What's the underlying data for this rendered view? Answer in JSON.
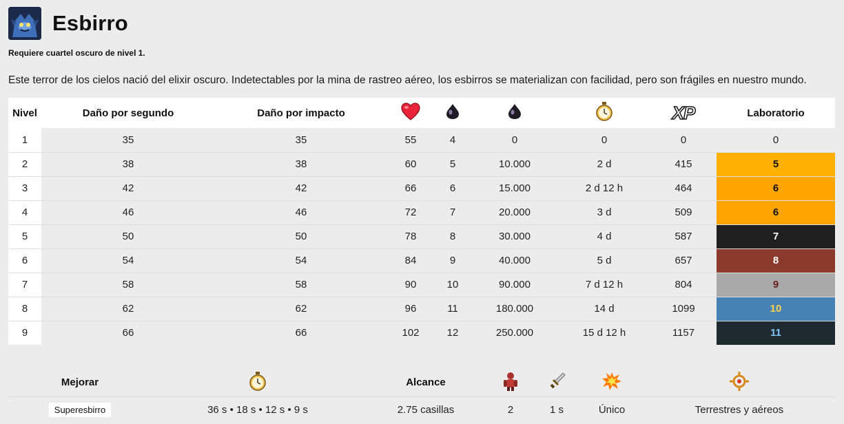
{
  "header": {
    "title": "Esbirro",
    "requirement": "Requiere cuartel oscuro de nivel 1.",
    "description": "Este terror de los cielos nació del elixir oscuro. Indetectables por la mina de rastreo aéreo, los esbirros se materializan con facilidad, pero son frágiles en nuestro mundo."
  },
  "table": {
    "headers": {
      "level": "Nivel",
      "dps": "Daño por segundo",
      "dph": "Daño por impacto",
      "hp_icon": "heart-icon",
      "housing_icon": "dark-elixir-drop-icon",
      "cost_icon": "dark-elixir-drop-icon",
      "time_icon": "stopwatch-icon",
      "xp": "XP",
      "lab": "Laboratorio"
    },
    "rows": [
      {
        "level": "1",
        "dps": "35",
        "dph": "35",
        "hp": "55",
        "housing": "4",
        "cost": "0",
        "time": "0",
        "xp": "0",
        "lab": "0"
      },
      {
        "level": "2",
        "dps": "38",
        "dph": "38",
        "hp": "60",
        "housing": "5",
        "cost": "10.000",
        "time": "2 d",
        "xp": "415",
        "lab": "5"
      },
      {
        "level": "3",
        "dps": "42",
        "dph": "42",
        "hp": "66",
        "housing": "6",
        "cost": "15.000",
        "time": "2 d 12 h",
        "xp": "464",
        "lab": "6"
      },
      {
        "level": "4",
        "dps": "46",
        "dph": "46",
        "hp": "72",
        "housing": "7",
        "cost": "20.000",
        "time": "3 d",
        "xp": "509",
        "lab": "6"
      },
      {
        "level": "5",
        "dps": "50",
        "dph": "50",
        "hp": "78",
        "housing": "8",
        "cost": "30.000",
        "time": "4 d",
        "xp": "587",
        "lab": "7"
      },
      {
        "level": "6",
        "dps": "54",
        "dph": "54",
        "hp": "84",
        "housing": "9",
        "cost": "40.000",
        "time": "5 d",
        "xp": "657",
        "lab": "8"
      },
      {
        "level": "7",
        "dps": "58",
        "dph": "58",
        "hp": "90",
        "housing": "10",
        "cost": "90.000",
        "time": "7 d 12 h",
        "xp": "804",
        "lab": "9"
      },
      {
        "level": "8",
        "dps": "62",
        "dph": "62",
        "hp": "96",
        "housing": "11",
        "cost": "180.000",
        "time": "14 d",
        "xp": "1099",
        "lab": "10"
      },
      {
        "level": "9",
        "dps": "66",
        "dph": "66",
        "hp": "102",
        "housing": "12",
        "cost": "250.000",
        "time": "15 d 12 h",
        "xp": "1157",
        "lab": "11"
      }
    ],
    "lab_colors": [
      {
        "bg": "transparent",
        "fg": "#222222"
      },
      {
        "bg": "#FFB000",
        "fg": "#111111"
      },
      {
        "bg": "#FFA500",
        "fg": "#111111"
      },
      {
        "bg": "#FFA500",
        "fg": "#111111"
      },
      {
        "bg": "#1f1f1f",
        "fg": "#ffffff"
      },
      {
        "bg": "#8B3A2B",
        "fg": "#ffffff"
      },
      {
        "bg": "#A9A9A9",
        "fg": "#6B1F1F"
      },
      {
        "bg": "#4682B4",
        "fg": "#FFD24D"
      },
      {
        "bg": "#1E2A30",
        "fg": "#7FC4FF"
      }
    ]
  },
  "bottom": {
    "headers": {
      "upgrade": "Mejorar",
      "time_icon": "stopwatch-icon",
      "range": "Alcance",
      "housing_icon": "troop-housing-icon",
      "attack_speed_icon": "sword-icon",
      "target_icon": "explosion-icon",
      "targets_icon": "crosshair-icon"
    },
    "values": {
      "upgrade": "Superesbirro",
      "times": "36 s • 18 s • 12 s • 9 s",
      "range": "2.75 casillas",
      "housing": "2",
      "attack_speed": "1 s",
      "damage_type": "Único",
      "targets": "Terrestres y aéreos"
    }
  }
}
